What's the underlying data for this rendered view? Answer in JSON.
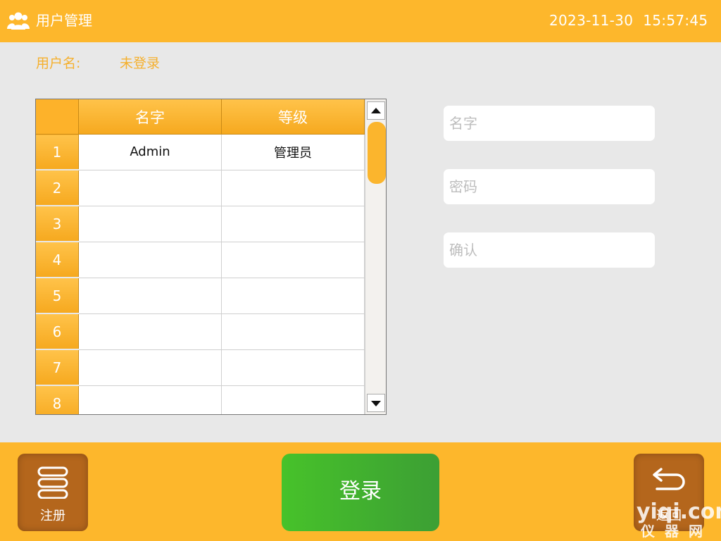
{
  "header": {
    "title": "用户管理",
    "title_icon": "users-icon",
    "date": "2023-11-30",
    "time": "15:57:45"
  },
  "user_status": {
    "label": "用户名:",
    "value": "未登录"
  },
  "user_table": {
    "columns": [
      "名字",
      "等级"
    ],
    "rows": [
      {
        "index": "1",
        "name": "Admin",
        "level": "管理员"
      },
      {
        "index": "2",
        "name": "",
        "level": ""
      },
      {
        "index": "3",
        "name": "",
        "level": ""
      },
      {
        "index": "4",
        "name": "",
        "level": ""
      },
      {
        "index": "5",
        "name": "",
        "level": ""
      },
      {
        "index": "6",
        "name": "",
        "level": ""
      },
      {
        "index": "7",
        "name": "",
        "level": ""
      },
      {
        "index": "8",
        "name": "",
        "level": ""
      }
    ]
  },
  "form": {
    "name_placeholder": "名字",
    "password_placeholder": "密码",
    "confirm_placeholder": "确认"
  },
  "buttons": {
    "register": "注册",
    "login": "登录",
    "back": "返回"
  },
  "watermark": {
    "line1": "yiqi.com",
    "line2": "仪器网"
  },
  "colors": {
    "accent": "#fdb72c",
    "button_dark": "#b4661c",
    "login_green": "#47c22a",
    "background": "#e8e8e8"
  }
}
